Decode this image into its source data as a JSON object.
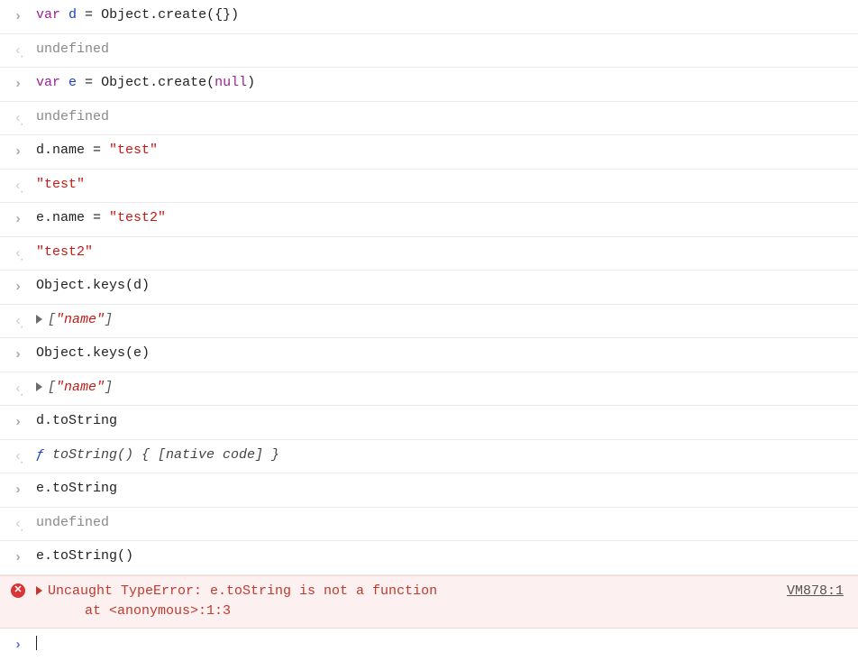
{
  "lines": {
    "l1": {
      "keyword": "var",
      "varname": "d",
      "eq": " = ",
      "obj": "Object.create({})"
    },
    "l2": {
      "result": "undefined"
    },
    "l3": {
      "keyword": "var",
      "varname": "e",
      "eq": " = ",
      "obj1": "Object.create(",
      "nullkw": "null",
      "obj2": ")"
    },
    "l4": {
      "result": "undefined"
    },
    "l5": {
      "lhs": "d.name",
      "eq": " = ",
      "str": "\"test\""
    },
    "l6": {
      "result": "\"test\""
    },
    "l7": {
      "lhs": "e.name",
      "eq": " = ",
      "str": "\"test2\""
    },
    "l8": {
      "result": "\"test2\""
    },
    "l9": {
      "code": "Object.keys(d)"
    },
    "l10": {
      "open": "[",
      "val": "\"name\"",
      "close": "]"
    },
    "l11": {
      "code": "Object.keys(e)"
    },
    "l12": {
      "open": "[",
      "val": "\"name\"",
      "close": "]"
    },
    "l13": {
      "code": "d.toString"
    },
    "l14": {
      "f": "ƒ",
      "body": " toString() { [native code] }"
    },
    "l15": {
      "code": "e.toString"
    },
    "l16": {
      "result": "undefined"
    },
    "l17": {
      "code": "e.toString()"
    },
    "error": {
      "msg1": "Uncaught TypeError: e.toString is not a function",
      "msg2": "    at <anonymous>:1:3",
      "source": "VM878:1"
    }
  }
}
